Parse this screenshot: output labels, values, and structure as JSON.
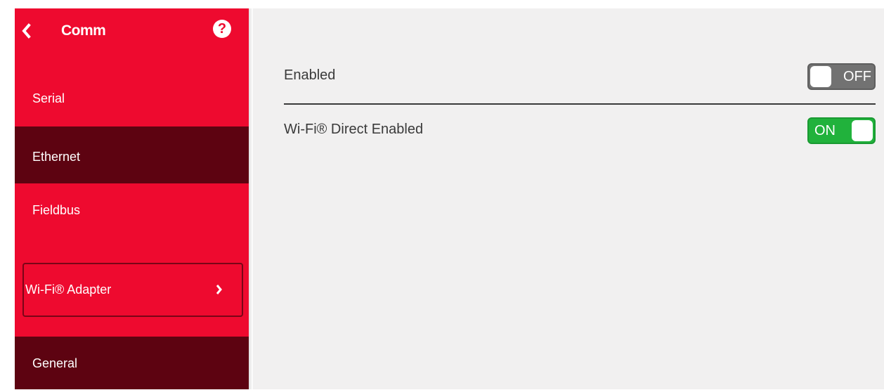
{
  "sidebar": {
    "title": "Comm",
    "help_glyph": "?",
    "items": [
      {
        "label": "Serial",
        "active": false
      },
      {
        "label": "Ethernet",
        "active": true
      },
      {
        "label": "Fieldbus",
        "active": false
      }
    ],
    "group": {
      "label": "Wi-Fi® Adapter",
      "icon": "chevron-right-icon"
    },
    "sub_items": [
      {
        "label": "General",
        "active": true
      }
    ],
    "icons": {
      "back": "chevron-left-icon",
      "help": "help-icon"
    }
  },
  "main": {
    "settings": [
      {
        "label": "Enabled",
        "toggle_text": "OFF",
        "state": "off"
      },
      {
        "label": "Wi-Fi® Direct Enabled",
        "toggle_text": "ON",
        "state": "on"
      }
    ]
  },
  "colors": {
    "sidebar_bg": "#ee0a2f",
    "sidebar_active": "#5d0311",
    "main_bg": "#f1f0f0",
    "toggle_off": "#727272",
    "toggle_on": "#21b23c"
  }
}
